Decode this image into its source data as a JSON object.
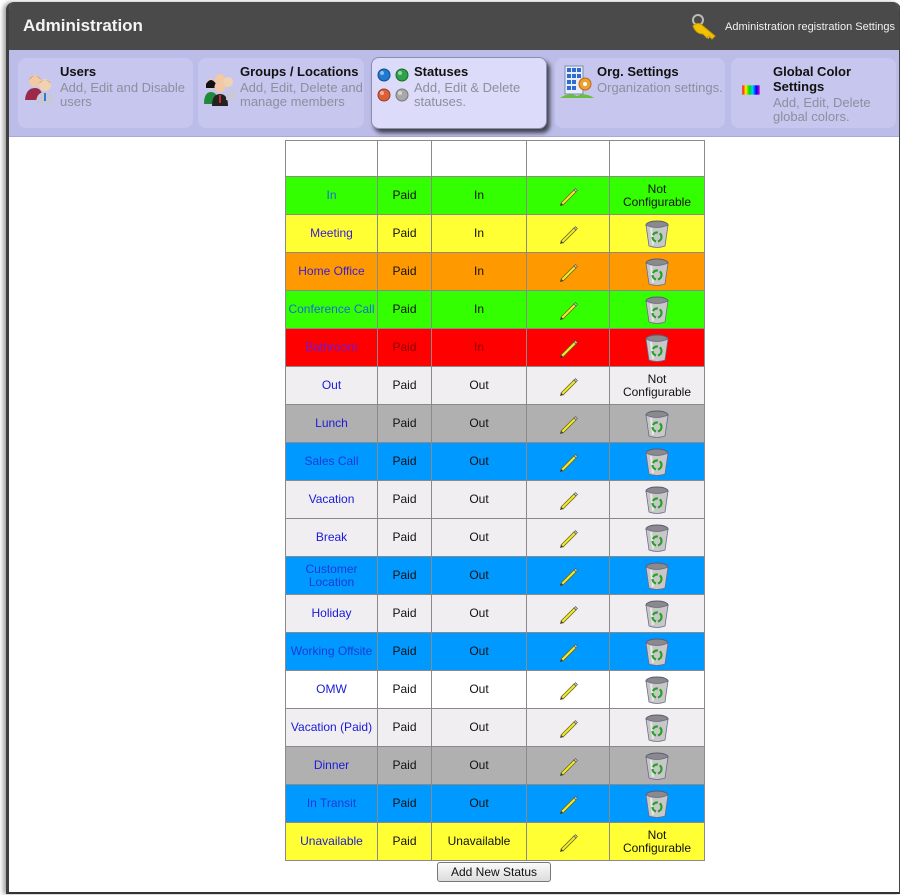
{
  "window": {
    "title": "Administration",
    "registration_link": "Administration registration Settings"
  },
  "nav": {
    "tiles": [
      {
        "name": "Users",
        "desc": "Add, Edit and Disable\nusers",
        "icon": "users-icon",
        "active": false
      },
      {
        "name": "Groups / Locations",
        "desc": "Add, Edit, Delete and\nmanage members",
        "icon": "groups-icon",
        "active": false
      },
      {
        "name": "Statuses",
        "desc": "Add, Edit & Delete\nstatuses.",
        "icon": "statuses-icon",
        "active": true
      },
      {
        "name": "Org. Settings",
        "desc": "Organization settings.",
        "icon": "org-settings-icon",
        "active": false
      },
      {
        "name": "Global Color Settings",
        "desc": "Add, Edit, Delete\nglobal colors.",
        "icon": "color-spectrum-icon",
        "active": false
      }
    ]
  },
  "table": {
    "headers": [
      "",
      "",
      "",
      "",
      ""
    ],
    "not_configurable_label": "Not\nConfigurable",
    "rows": [
      {
        "name": "In",
        "pay": "Paid",
        "type": "In",
        "color": "#33ff00",
        "deletable": false,
        "name_color": "#1a6ad8"
      },
      {
        "name": "Meeting",
        "pay": "Paid",
        "type": "In",
        "color": "#ffff33",
        "deletable": true,
        "name_color": "#3a1ad8"
      },
      {
        "name": "Home Office",
        "pay": "Paid",
        "type": "In",
        "color": "#ff9900",
        "deletable": true,
        "name_color": "#3a1ad8"
      },
      {
        "name": "Conference Call",
        "pay": "Paid",
        "type": "In",
        "color": "#33ff00",
        "deletable": true,
        "name_color": "#1a6ad8"
      },
      {
        "name": "Bathroom",
        "pay": "Paid",
        "type": "In",
        "color": "#ff0000",
        "deletable": true,
        "name_color": "#6a1ad8",
        "text_color": "#8a0000"
      },
      {
        "name": "Out",
        "pay": "Paid",
        "type": "Out",
        "color": "#f0eef0",
        "deletable": false,
        "name_color": "#1a1ad8"
      },
      {
        "name": "Lunch",
        "pay": "Paid",
        "type": "Out",
        "color": "#b0b0b0",
        "deletable": true,
        "name_color": "#1a1ad8"
      },
      {
        "name": "Sales Call",
        "pay": "Paid",
        "type": "Out",
        "color": "#0099ff",
        "deletable": true,
        "name_color": "#1a3ad8"
      },
      {
        "name": "Vacation",
        "pay": "Paid",
        "type": "Out",
        "color": "#f0eef0",
        "deletable": true,
        "name_color": "#1a1ad8"
      },
      {
        "name": "Break",
        "pay": "Paid",
        "type": "Out",
        "color": "#f0eef0",
        "deletable": true,
        "name_color": "#1a1ad8"
      },
      {
        "name": "Customer Location",
        "pay": "Paid",
        "type": "Out",
        "color": "#0099ff",
        "deletable": true,
        "name_color": "#1a3ad8"
      },
      {
        "name": "Holiday",
        "pay": "Paid",
        "type": "Out",
        "color": "#f0eef0",
        "deletable": true,
        "name_color": "#1a1ad8"
      },
      {
        "name": "Working Offsite",
        "pay": "Paid",
        "type": "Out",
        "color": "#0099ff",
        "deletable": true,
        "name_color": "#1a3ad8"
      },
      {
        "name": "OMW",
        "pay": "Paid",
        "type": "Out",
        "color": "#ffffff",
        "deletable": true,
        "name_color": "#1a1ad8"
      },
      {
        "name": "Vacation (Paid)",
        "pay": "Paid",
        "type": "Out",
        "color": "#f0eef0",
        "deletable": true,
        "name_color": "#1a1ad8"
      },
      {
        "name": "Dinner",
        "pay": "Paid",
        "type": "Out",
        "color": "#b0b0b0",
        "deletable": true,
        "name_color": "#1a1ad8"
      },
      {
        "name": "In Transit",
        "pay": "Paid",
        "type": "Out",
        "color": "#0099ff",
        "deletable": true,
        "name_color": "#1a3ad8"
      },
      {
        "name": "Unavailable",
        "pay": "Paid",
        "type": "Unavailable",
        "color": "#ffff33",
        "deletable": false,
        "name_color": "#1a1ad8"
      }
    ]
  },
  "actions": {
    "add_new_status": "Add New Status"
  }
}
